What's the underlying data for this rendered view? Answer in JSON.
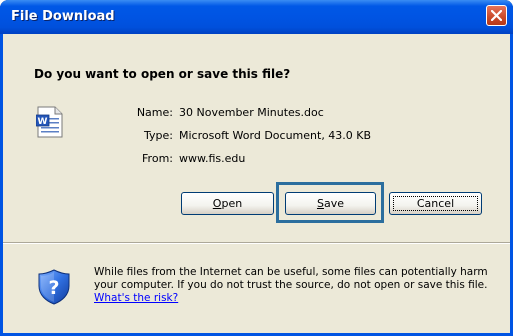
{
  "window": {
    "title": "File Download",
    "close_label": "×"
  },
  "dialog": {
    "question": "Do you want to open or save this file?",
    "file_icon": "word-document-icon",
    "fields": [
      {
        "key": "Name:",
        "value": "30 November Minutes.doc"
      },
      {
        "key": "Type:",
        "value": "Microsoft Word Document, 43.0 KB"
      },
      {
        "key": "From:",
        "value": "www.fis.edu"
      }
    ]
  },
  "buttons": {
    "open": {
      "pre": "",
      "accel": "O",
      "post": "pen"
    },
    "save": {
      "pre": "",
      "accel": "S",
      "post": "ave"
    },
    "cancel": "Cancel"
  },
  "warning": {
    "icon": "shield-question-icon",
    "text": "While files from the Internet can be useful, some files can potentially harm your computer. If you do not trust the source, do not open or save this file. ",
    "link": "What's the risk?"
  },
  "colors": {
    "title_bar": "#0054e3",
    "dialog_bg": "#ece9d8",
    "highlight": "#2b6e9e",
    "link": "#0000ff"
  }
}
